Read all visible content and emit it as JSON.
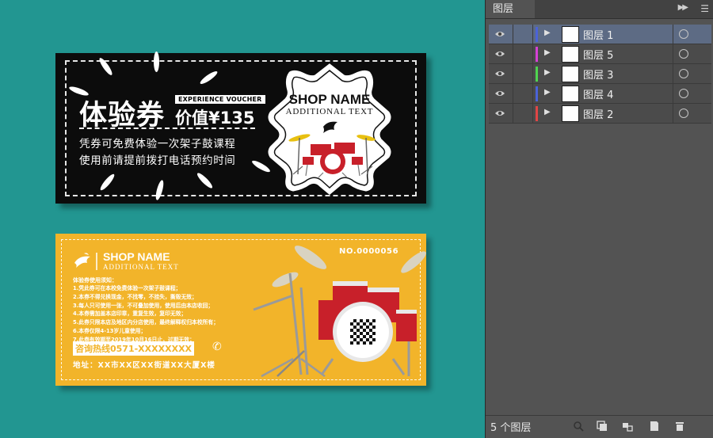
{
  "black_voucher": {
    "title": "体验券",
    "badge": "EXPERIENCE VOUCHER",
    "value_label": "价值¥135",
    "line1": "凭券可免费体验一次架子鼓课程",
    "line2": "使用前请提前拨打电话预约时间",
    "shop_name": "SHOP NAME",
    "additional_text": "ADDITIONAL TEXT"
  },
  "yellow_voucher": {
    "shop_name": "SHOP NAME",
    "additional_text": "ADDITIONAL TEXT",
    "serial": "NO.0000056",
    "rules_title": "体验券使用须知：",
    "rules": [
      "1.凭此券可在本校免费体验一次架子鼓课程；",
      "2.本券不得兑换现金，不找零，不挂失，撕毁无效；",
      "3.每人只可使用一张，不可叠加使用，使用后由本店收回；",
      "4.本券需加盖本店印章，重复生效，复印无效；",
      "5.此券只限本店及地区内分店使用，最终解释权归本校所有；",
      "6.本券仅限4-13岁儿童使用；",
      "7.此券有效期至2019年10月16日止，过期无效；"
    ],
    "hotline": "咨询热线0571-XXXXXXXX",
    "address": "地址：XX市XX区XX街道XX大厦X楼"
  },
  "layers_panel": {
    "tab_label": "图层",
    "footer_count": "5 个图层",
    "layers": [
      {
        "name": "图层 1",
        "color": "#4b63d8",
        "selected": true
      },
      {
        "name": "图层 5",
        "color": "#d641d6",
        "selected": false
      },
      {
        "name": "图层 3",
        "color": "#4fd44f",
        "selected": false
      },
      {
        "name": "图层 4",
        "color": "#4b63d8",
        "selected": false
      },
      {
        "name": "图层 2",
        "color": "#e04545",
        "selected": false
      }
    ]
  },
  "colors": {
    "canvas_bg": "#229691",
    "yellow_card": "#f2b42a",
    "black_card": "#0c0c0c",
    "drum_red": "#c8202a"
  }
}
